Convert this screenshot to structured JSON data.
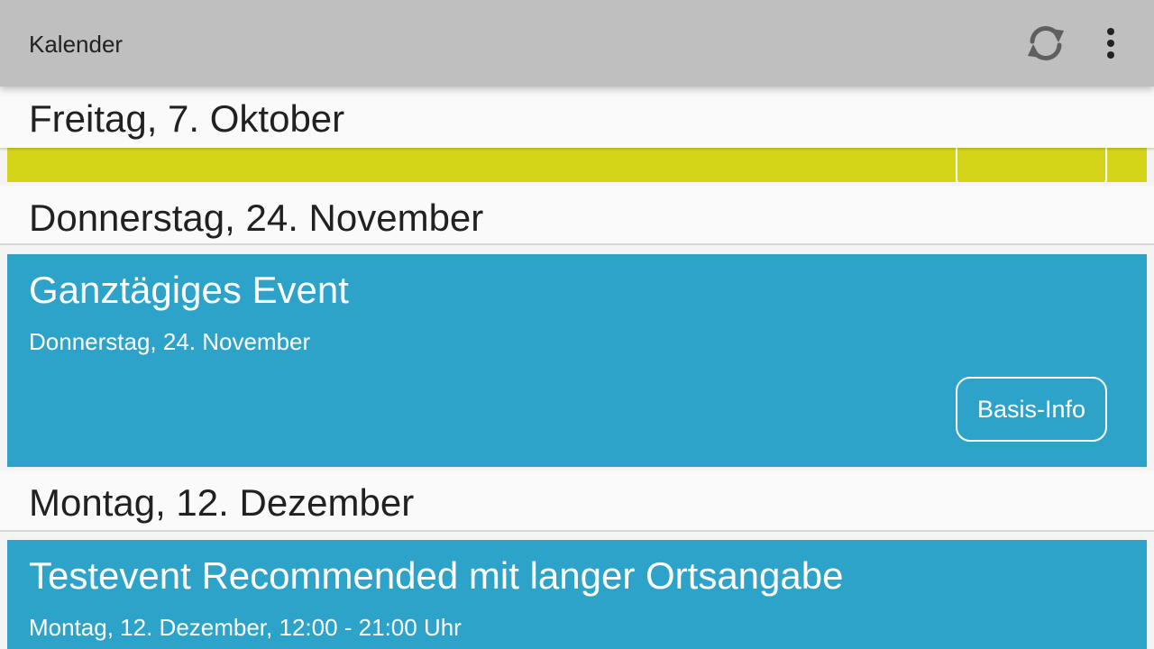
{
  "toolbar": {
    "title": "Kalender",
    "sync_icon": "sync-icon",
    "more_icon": "more-vert-icon"
  },
  "sections": [
    {
      "header": "Freitag, 7. Oktober",
      "event": {
        "color": "#d4d519",
        "button": ""
      }
    },
    {
      "header": "Donnerstag, 24. November",
      "event": {
        "color": "#2ea3ca",
        "title": "Ganztägiges Event",
        "subtitle": "Donnerstag, 24. November",
        "button": "Basis-Info"
      }
    },
    {
      "header": "Montag, 12. Dezember",
      "event": {
        "color": "#2ea3ca",
        "title": "Testevent Recommended mit langer Ortsangabe",
        "subtitle": "Montag, 12. Dezember, 12:00 - 21:00 Uhr"
      }
    }
  ],
  "colors": {
    "toolbar": "#bfbfbf",
    "event_yellow": "#d4d519",
    "event_blue": "#2ea3ca",
    "header_bg": "#fafafa"
  }
}
